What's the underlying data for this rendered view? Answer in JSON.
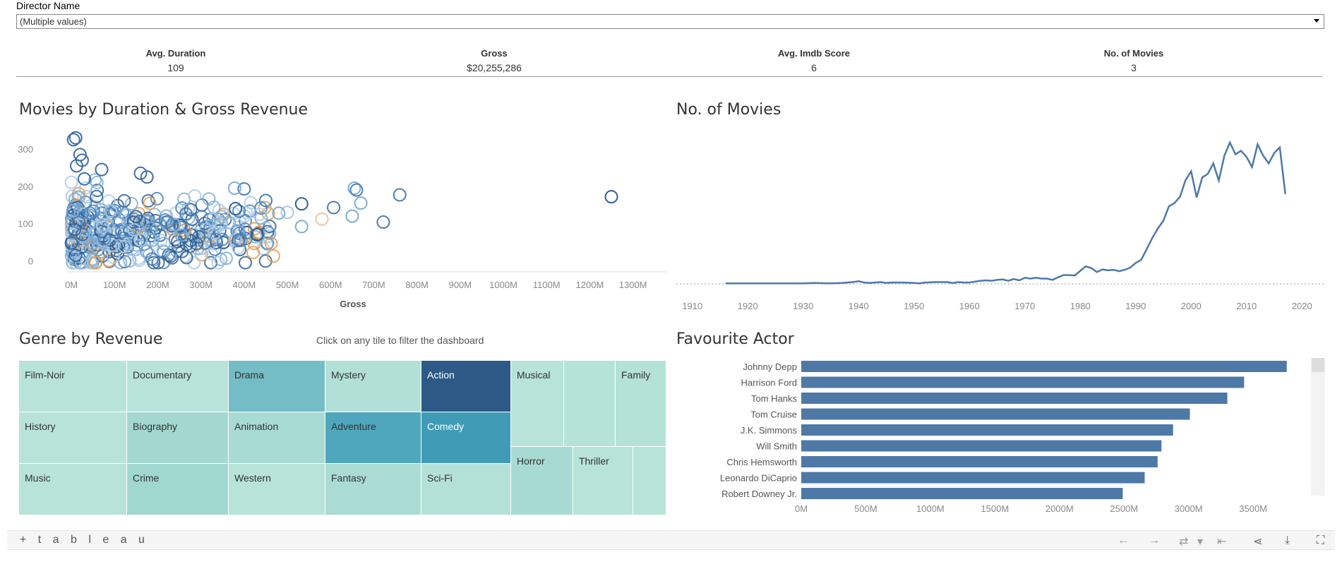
{
  "filter": {
    "label": "Director Name",
    "value": "(Multiple values)"
  },
  "kpis": [
    {
      "title": "Avg. Duration",
      "value": "109"
    },
    {
      "title": "Gross",
      "value": "$20,255,286"
    },
    {
      "title": "Avg. Imdb Score",
      "value": "6"
    },
    {
      "title": "No. of Movies",
      "value": "3"
    }
  ],
  "scatter": {
    "title": "Movies by Duration & Gross Revenue",
    "chart_data": {
      "type": "scatter",
      "xlabel": "Gross",
      "ylabel": "",
      "x_ticks": [
        "0M",
        "100M",
        "200M",
        "300M",
        "400M",
        "500M",
        "600M",
        "700M",
        "800M",
        "900M",
        "1000M",
        "1100M",
        "1200M",
        "1300M"
      ],
      "y_ticks": [
        "0",
        "100",
        "200",
        "300"
      ],
      "xlim": [
        -10,
        1330
      ],
      "ylim": [
        -20,
        340
      ],
      "colors": [
        "#2f5f92",
        "#4a7fb5",
        "#7eaed6",
        "#a9c9e8",
        "#e39b52",
        "#f0c4a6"
      ],
      "points": [
        {
          "x": 1250,
          "y": 172,
          "c": 0
        },
        {
          "x": 760,
          "y": 177,
          "c": 1
        },
        {
          "x": 722,
          "y": 104,
          "c": 1
        },
        {
          "x": 670,
          "y": 155,
          "c": 2
        },
        {
          "x": 655,
          "y": 195,
          "c": 2
        },
        {
          "x": 660,
          "y": 190,
          "c": 1
        },
        {
          "x": 650,
          "y": 120,
          "c": 2
        },
        {
          "x": 607,
          "y": 143,
          "c": 1
        },
        {
          "x": 580,
          "y": 112,
          "c": 5
        },
        {
          "x": 533,
          "y": 153,
          "c": 0
        },
        {
          "x": 533,
          "y": 92,
          "c": 2
        },
        {
          "x": 500,
          "y": 130,
          "c": 3
        },
        {
          "x": 480,
          "y": 128,
          "c": 2
        },
        {
          "x": 450,
          "y": 162,
          "c": 1
        },
        {
          "x": 430,
          "y": 70,
          "c": 0
        },
        {
          "x": 400,
          "y": 193,
          "c": 1
        },
        {
          "x": 378,
          "y": 195,
          "c": 2
        },
        {
          "x": 380,
          "y": 140,
          "c": 0
        }
      ]
    }
  },
  "line": {
    "title": "No. of Movies",
    "chart_data": {
      "type": "line",
      "x_ticks": [
        "1910",
        "1920",
        "1930",
        "1940",
        "1950",
        "1960",
        "1970",
        "1980",
        "1990",
        "2000",
        "2010",
        "2020"
      ],
      "xlim": [
        1908,
        2022
      ],
      "ylim": [
        0,
        340
      ],
      "x": [
        1916,
        1920,
        1925,
        1930,
        1932,
        1935,
        1937,
        1938,
        1939,
        1940,
        1941,
        1942,
        1944,
        1945,
        1946,
        1948,
        1950,
        1951,
        1952,
        1954,
        1955,
        1956,
        1957,
        1958,
        1959,
        1960,
        1961,
        1962,
        1963,
        1964,
        1965,
        1966,
        1967,
        1968,
        1969,
        1970,
        1971,
        1972,
        1973,
        1974,
        1975,
        1976,
        1977,
        1978,
        1979,
        1980,
        1981,
        1982,
        1983,
        1984,
        1985,
        1986,
        1987,
        1988,
        1989,
        1990,
        1991,
        1992,
        1993,
        1994,
        1995,
        1996,
        1997,
        1998,
        1999,
        2000,
        2001,
        2002,
        2003,
        2004,
        2005,
        2006,
        2007,
        2008,
        2009,
        2010,
        2011,
        2012,
        2013,
        2014,
        2015,
        2016,
        2017
      ],
      "values": [
        1,
        1,
        1,
        1,
        2,
        1,
        2,
        3,
        4,
        6,
        3,
        2,
        4,
        2,
        3,
        3,
        2,
        1,
        3,
        4,
        4,
        4,
        2,
        4,
        3,
        3,
        5,
        7,
        8,
        7,
        9,
        10,
        7,
        11,
        8,
        14,
        12,
        14,
        12,
        12,
        9,
        15,
        20,
        20,
        19,
        30,
        40,
        36,
        27,
        33,
        31,
        32,
        29,
        32,
        37,
        48,
        55,
        80,
        105,
        127,
        145,
        178,
        185,
        200,
        238,
        258,
        198,
        244,
        252,
        276,
        237,
        294,
        324,
        297,
        305,
        291,
        268,
        320,
        294,
        276,
        300,
        313,
        206
      ]
    }
  },
  "treemap": {
    "title": "Genre by Revenue",
    "hint": "Click on any tile to filter the dashboard",
    "tiles": [
      {
        "label": "Film-Noir",
        "color": "#b7e3d8"
      },
      {
        "label": "Documentary",
        "color": "#b8e3d9"
      },
      {
        "label": "Drama",
        "color": "#74bcc6"
      },
      {
        "label": "Mystery",
        "color": "#b3e0d6"
      },
      {
        "label": "Action",
        "color": "#2c5985"
      },
      {
        "label": "Musical",
        "color": "#b7e3d8"
      },
      {
        "label": "",
        "color": "#b5e3d8"
      },
      {
        "label": "Family",
        "color": "#b5e2d7"
      },
      {
        "label": "History",
        "color": "#b8e3d9"
      },
      {
        "label": "Biography",
        "color": "#a2d8d0"
      },
      {
        "label": "Animation",
        "color": "#a8dbd2"
      },
      {
        "label": "Adventure",
        "color": "#4ea7bd"
      },
      {
        "label": "Comedy",
        "color": "#3f9bb6"
      },
      {
        "label": "Horror",
        "color": "#a7dad2"
      },
      {
        "label": "Thriller",
        "color": "#b7e3d8"
      },
      {
        "label": "",
        "color": "#b7e3d8"
      },
      {
        "label": "Music",
        "color": "#b8e3d9"
      },
      {
        "label": "Crime",
        "color": "#a0d7cf"
      },
      {
        "label": "Western",
        "color": "#b7e3d8"
      },
      {
        "label": "Fantasy",
        "color": "#aadcd3"
      },
      {
        "label": "Sci-Fi",
        "color": "#b4e1d7"
      }
    ]
  },
  "bars": {
    "title": "Favourite Actor",
    "chart_data": {
      "type": "bar",
      "orientation": "horizontal",
      "categories": [
        "Johnny Depp",
        "Harrison Ford",
        "Tom Hanks",
        "Tom Cruise",
        "J.K. Simmons",
        "Will Smith",
        "Chris Hemsworth",
        "Leonardo DiCaprio",
        "Robert Downey Jr."
      ],
      "values": [
        3760,
        3430,
        3300,
        3010,
        2880,
        2790,
        2760,
        2660,
        2490
      ],
      "x_ticks": [
        "0M",
        "500M",
        "1000M",
        "1500M",
        "2000M",
        "2500M",
        "3000M",
        "3500M"
      ],
      "xlim": [
        0,
        3800
      ],
      "color": "#4e79a7"
    }
  },
  "toolbar": {
    "logo": "+ t a b l e a u",
    "buttons": [
      {
        "name": "undo-icon",
        "glyph": "←"
      },
      {
        "name": "redo-icon",
        "glyph": "→"
      },
      {
        "name": "revert-icon",
        "glyph": "⇄"
      },
      {
        "name": "pause-icon",
        "glyph": "▾"
      },
      {
        "name": "reset-icon",
        "glyph": "⇤"
      },
      {
        "name": "share-icon",
        "glyph": "⋖"
      },
      {
        "name": "download-icon",
        "glyph": "⤓"
      },
      {
        "name": "fullscreen-icon",
        "glyph": "⛶"
      }
    ]
  }
}
